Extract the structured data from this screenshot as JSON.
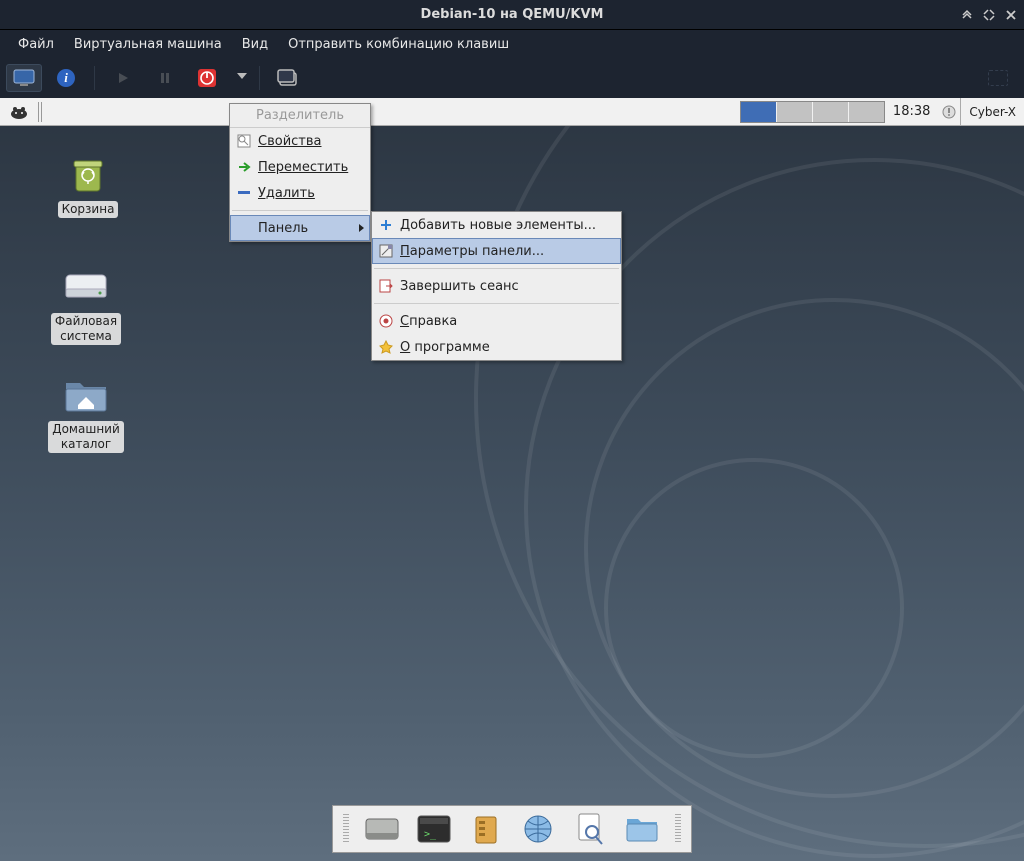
{
  "window": {
    "title": "Debian-10 на QEMU/KVM"
  },
  "menubar": {
    "file": "Файл",
    "vm": "Виртуальная машина",
    "view": "Вид",
    "sendkey": "Отправить комбинацию клавиш"
  },
  "panel": {
    "workspace_count": 4,
    "clock": "18:38",
    "user": "Cyber-X"
  },
  "ctxmenu": {
    "title": "Разделитель",
    "properties": "Свойства",
    "move": "Переместить",
    "remove": "Удалить",
    "panel": "Панель"
  },
  "submenu": {
    "add_items": "Добавить новые элементы...",
    "prefs": "Параметры панели...",
    "logout": "Завершить сеанс",
    "help": "Справка",
    "about": "О программе"
  },
  "icons": {
    "trash": "Корзина",
    "filesystem_l1": "Файловая",
    "filesystem_l2": "система",
    "home_l1": "Домашний",
    "home_l2": "каталог"
  }
}
